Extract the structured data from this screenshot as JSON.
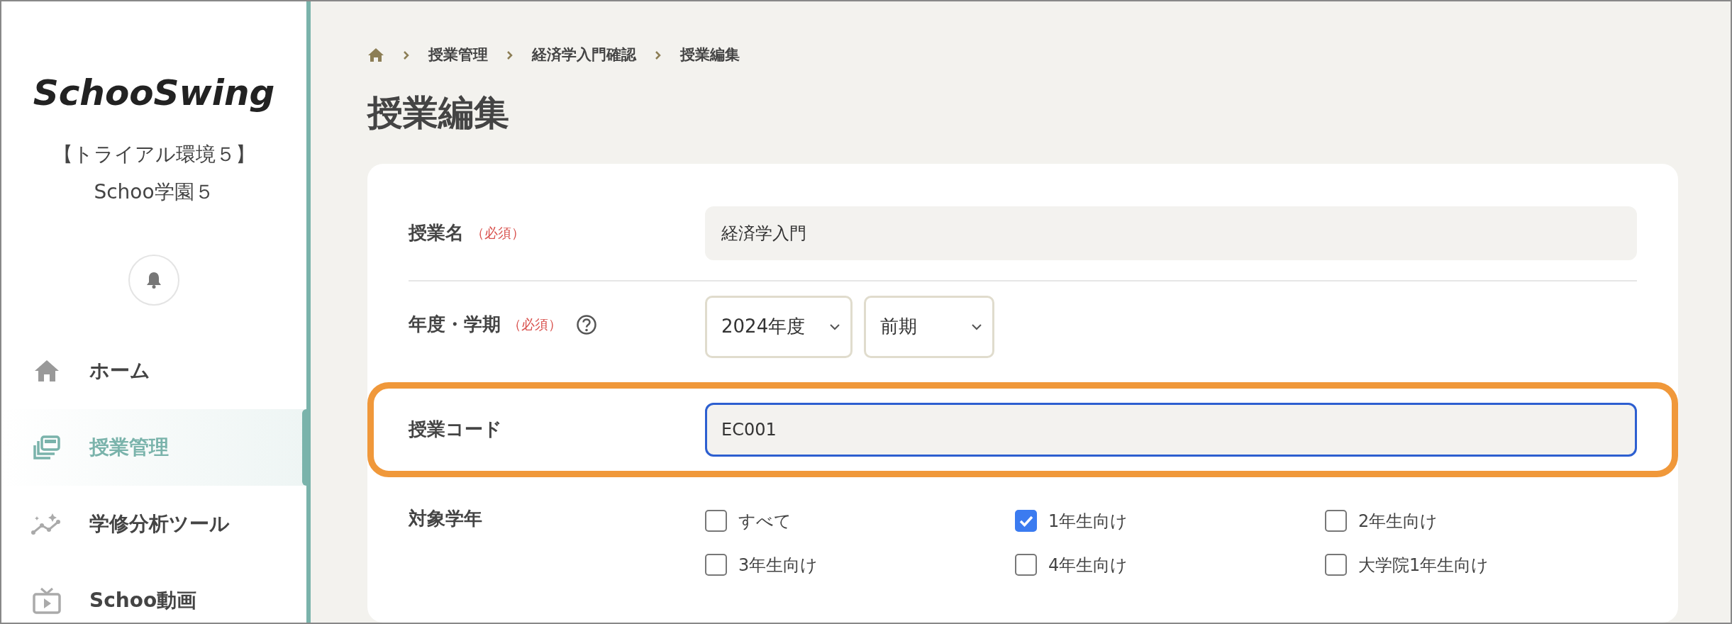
{
  "sidebar": {
    "logo": "SchooSwing",
    "organization": "【トライアル環境５】Schoo学園５",
    "items": [
      {
        "label": "ホーム",
        "selected": false
      },
      {
        "label": "授業管理",
        "selected": true
      },
      {
        "label": "学修分析ツール",
        "selected": false
      },
      {
        "label": "Schoo動画",
        "selected": false
      }
    ]
  },
  "breadcrumb": [
    "授業管理",
    "経済学入門確認",
    "授業編集"
  ],
  "title": "授業編集",
  "form": {
    "fields": [
      {
        "kind": "text",
        "label": "授業名",
        "required_mark": "（必須）",
        "value": "経済学入門",
        "focused": false,
        "highlighted": false
      },
      {
        "kind": "selects",
        "label": "年度・学期",
        "required_mark": "（必須）",
        "help": true,
        "selects": [
          "2024年度",
          "前期"
        ],
        "highlighted": false
      },
      {
        "kind": "text",
        "label": "授業コード",
        "value": "EC001",
        "focused": true,
        "highlighted": true
      },
      {
        "kind": "checkboxes",
        "label": "対象学年",
        "highlighted": false,
        "options": [
          {
            "label": "すべて",
            "checked": false
          },
          {
            "label": "1年生向け",
            "checked": true
          },
          {
            "label": "2年生向け",
            "checked": false
          },
          {
            "label": "3年生向け",
            "checked": false
          },
          {
            "label": "4年生向け",
            "checked": false
          },
          {
            "label": "大学院1年生向け",
            "checked": false
          }
        ]
      }
    ]
  }
}
